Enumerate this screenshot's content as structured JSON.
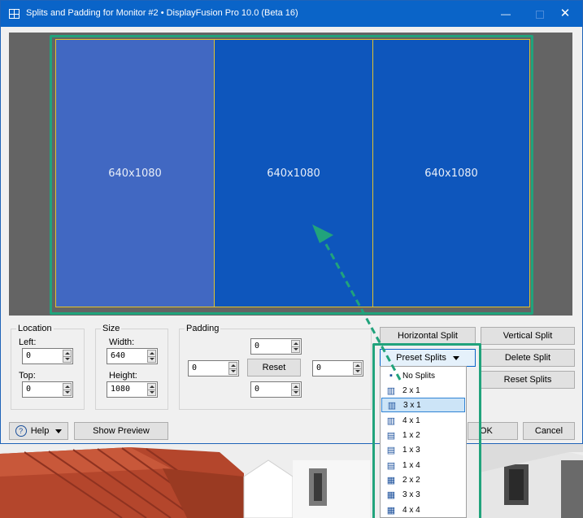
{
  "window": {
    "title": "Splits and Padding for Monitor #2 • DisplayFusion Pro 10.0 (Beta 16)",
    "minimize_glyph": "—",
    "close_glyph": "✕"
  },
  "preview": {
    "splits": [
      {
        "label": "640x1080"
      },
      {
        "label": "640x1080"
      },
      {
        "label": "640x1080"
      }
    ]
  },
  "location": {
    "title": "Location",
    "left_label": "Left:",
    "left_value": "0",
    "top_label": "Top:",
    "top_value": "0"
  },
  "size": {
    "title": "Size",
    "width_label": "Width:",
    "width_value": "640",
    "height_label": "Height:",
    "height_value": "1080"
  },
  "padding": {
    "title": "Padding",
    "top_value": "0",
    "left_value": "0",
    "right_value": "0",
    "bottom_value": "0",
    "reset_label": "Reset"
  },
  "buttons": {
    "horizontal_split": "Horizontal Split",
    "vertical_split": "Vertical Split",
    "preset_splits": "Preset Splits",
    "delete_split": "Delete Split",
    "reset_splits": "Reset Splits",
    "help": "Help",
    "show_preview": "Show Preview",
    "ok": "OK",
    "cancel": "Cancel"
  },
  "preset_menu": {
    "items": [
      {
        "label": "No Splits",
        "icon": "square-icon"
      },
      {
        "label": "2 x 1",
        "icon": "columns-2-icon"
      },
      {
        "label": "3 x 1",
        "icon": "columns-3-icon",
        "selected": true
      },
      {
        "label": "4 x 1",
        "icon": "columns-4-icon"
      },
      {
        "label": "1 x 2",
        "icon": "rows-2-icon"
      },
      {
        "label": "1 x 3",
        "icon": "rows-3-icon"
      },
      {
        "label": "1 x 4",
        "icon": "rows-4-icon"
      },
      {
        "label": "2 x 2",
        "icon": "grid-2x2-icon"
      },
      {
        "label": "3 x 3",
        "icon": "grid-3x3-icon"
      },
      {
        "label": "4 x 4",
        "icon": "grid-4x4-icon"
      }
    ]
  },
  "colors": {
    "titlebar": "#0a64c8",
    "split_active": "#4168c2",
    "split": "#0e56bc",
    "split_border": "#e2c22c",
    "annotation": "#21a37c"
  }
}
